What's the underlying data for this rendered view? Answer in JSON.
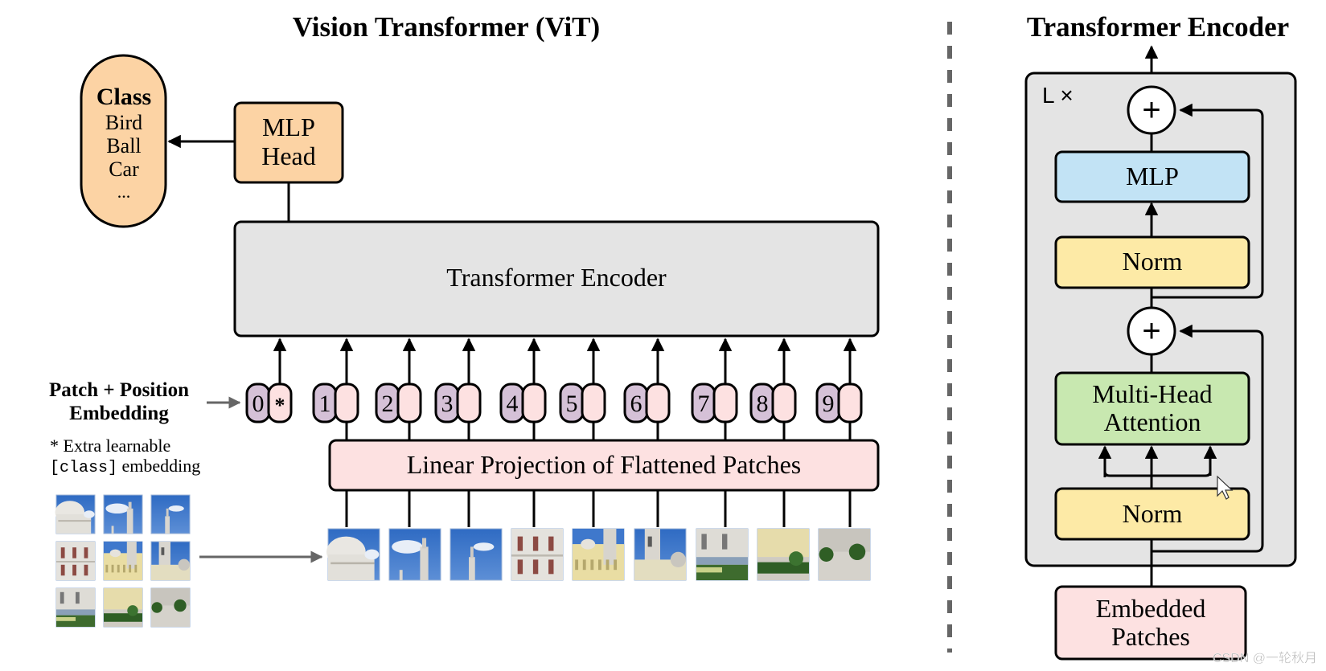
{
  "left_panel": {
    "title": "Vision Transformer (ViT)",
    "class_box": {
      "heading": "Class",
      "items": [
        "Bird",
        "Ball",
        "Car",
        "..."
      ]
    },
    "mlp_head": {
      "line1": "MLP",
      "line2": "Head"
    },
    "encoder_label": "Transformer Encoder",
    "embedding_label": {
      "line1": "Patch + Position",
      "line2": "Embedding"
    },
    "extra_note": {
      "line1": "* Extra learnable",
      "code": "[class]",
      "line2_rest": " embedding"
    },
    "tokens": [
      {
        "position": "0",
        "patch": "*"
      },
      {
        "position": "1",
        "patch": ""
      },
      {
        "position": "2",
        "patch": ""
      },
      {
        "position": "3",
        "patch": ""
      },
      {
        "position": "4",
        "patch": ""
      },
      {
        "position": "5",
        "patch": ""
      },
      {
        "position": "6",
        "patch": ""
      },
      {
        "position": "7",
        "patch": ""
      },
      {
        "position": "8",
        "patch": ""
      },
      {
        "position": "9",
        "patch": ""
      }
    ],
    "linear_projection_label": "Linear Projection of Flattened Patches",
    "image_patches": [
      "dome-sky",
      "sky-cloud-tower",
      "sky-spire",
      "white-facade",
      "yellow-palace",
      "tower-side",
      "street-cars",
      "garden-hedge",
      "plaza-trees"
    ]
  },
  "right_panel": {
    "title": "Transformer Encoder",
    "repeat_label": "L ×",
    "blocks": {
      "mlp": "MLP",
      "norm_top": "Norm",
      "attention": {
        "line1": "Multi-Head",
        "line2": "Attention"
      },
      "norm_bottom": "Norm",
      "embedded": {
        "line1": "Embedded",
        "line2": "Patches"
      }
    },
    "add_symbol": "+"
  },
  "watermark": "CSDN @一轮秋月",
  "colors": {
    "orange": "#fcd3a4",
    "gray_box": "#e4e4e4",
    "pink": "#fde1e1",
    "purple": "#d5c1d7",
    "blue": "#c2e3f5",
    "yellow": "#fdeaa6",
    "green": "#c8e8b0",
    "separator": "#666666"
  }
}
